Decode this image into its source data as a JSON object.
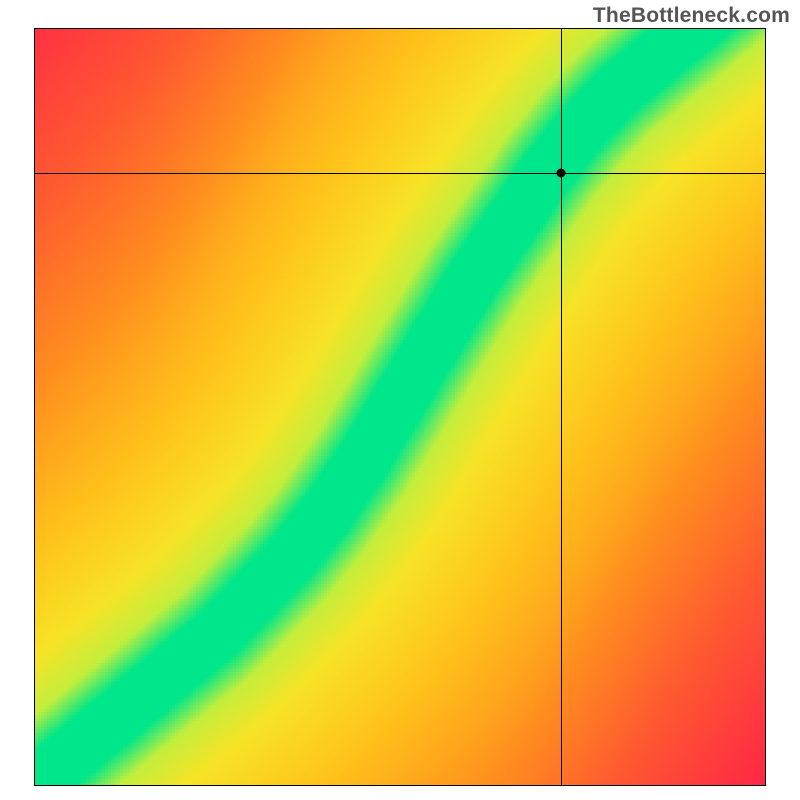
{
  "watermark": "TheBottleneck.com",
  "chart_data": {
    "type": "heatmap",
    "title": "",
    "xlabel": "",
    "ylabel": "",
    "xlim": [
      0,
      1
    ],
    "ylim": [
      0,
      1
    ],
    "ridge": [
      {
        "x": 0.0,
        "y": 0.0
      },
      {
        "x": 0.05,
        "y": 0.04
      },
      {
        "x": 0.1,
        "y": 0.08
      },
      {
        "x": 0.15,
        "y": 0.12
      },
      {
        "x": 0.2,
        "y": 0.16
      },
      {
        "x": 0.25,
        "y": 0.2
      },
      {
        "x": 0.3,
        "y": 0.25
      },
      {
        "x": 0.35,
        "y": 0.3
      },
      {
        "x": 0.4,
        "y": 0.36
      },
      {
        "x": 0.45,
        "y": 0.43
      },
      {
        "x": 0.5,
        "y": 0.51
      },
      {
        "x": 0.55,
        "y": 0.59
      },
      {
        "x": 0.6,
        "y": 0.67
      },
      {
        "x": 0.65,
        "y": 0.74
      },
      {
        "x": 0.7,
        "y": 0.81
      },
      {
        "x": 0.75,
        "y": 0.87
      },
      {
        "x": 0.8,
        "y": 0.92
      },
      {
        "x": 0.85,
        "y": 0.96
      },
      {
        "x": 0.9,
        "y": 1.0
      }
    ],
    "ridge_width": 0.035,
    "marker": {
      "x": 0.72,
      "y": 0.81
    },
    "crosshair": {
      "x": 0.72,
      "y": 0.81
    },
    "color_stops": [
      {
        "d": 0.0,
        "color": "#00e68a"
      },
      {
        "d": 0.04,
        "color": "#c3ee3c"
      },
      {
        "d": 0.1,
        "color": "#f7e326"
      },
      {
        "d": 0.22,
        "color": "#ffc21a"
      },
      {
        "d": 0.4,
        "color": "#ff8c1f"
      },
      {
        "d": 0.62,
        "color": "#ff5a30"
      },
      {
        "d": 1.0,
        "color": "#ff184c"
      }
    ]
  }
}
